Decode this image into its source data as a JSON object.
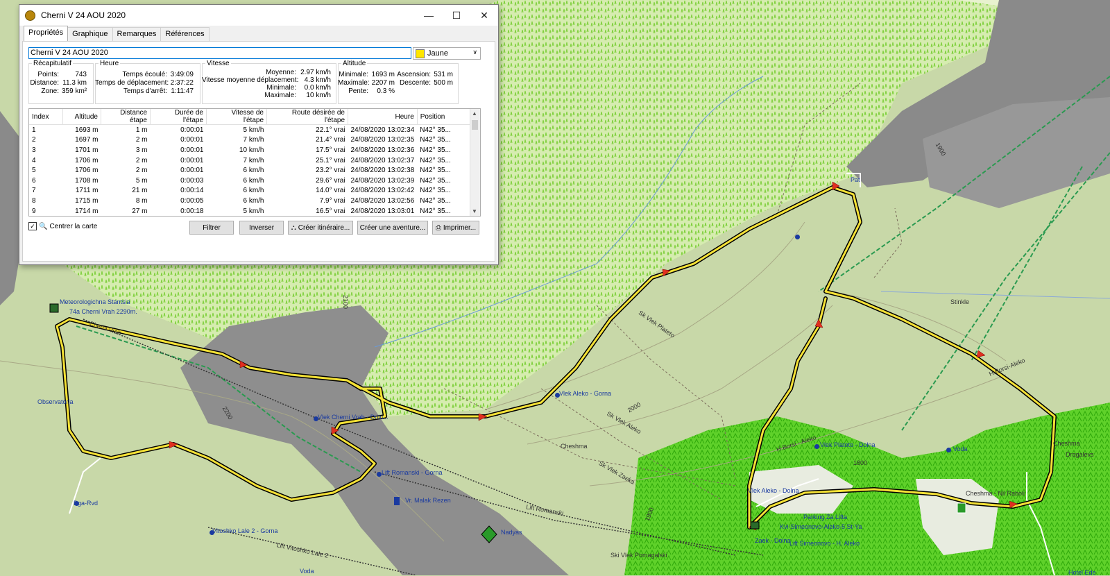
{
  "window": {
    "title": "Cherni V 24 AOU 2020"
  },
  "tabs": [
    "Propriétés",
    "Graphique",
    "Remarques",
    "Références"
  ],
  "name_value": "Cherni V 24 AOU 2020",
  "color": {
    "label": "Jaune",
    "swatch": "#ffe600"
  },
  "recap": {
    "legend": "Récapitulatif",
    "rows": [
      {
        "label": "Points:",
        "value": "743"
      },
      {
        "label": "Distance:",
        "value": "11.3 km"
      },
      {
        "label": "Zone:",
        "value": "359 km²"
      }
    ]
  },
  "heure": {
    "legend": "Heure",
    "rows": [
      {
        "label": "Temps écoulé:",
        "value": "3:49:09"
      },
      {
        "label": "Temps de déplacement:",
        "value": "2:37:22"
      },
      {
        "label": "Temps d'arrêt:",
        "value": "1:11:47"
      }
    ]
  },
  "vitesse": {
    "legend": "Vitesse",
    "rows": [
      {
        "label": "Moyenne:",
        "value": "2.97 km/h"
      },
      {
        "label": "Vitesse moyenne déplacement:",
        "value": "4.3 km/h"
      },
      {
        "label": "Minimale:",
        "value": "0.0 km/h"
      },
      {
        "label": "Maximale:",
        "value": "10 km/h"
      }
    ]
  },
  "altitude": {
    "legend": "Altitude",
    "rows": [
      {
        "label": "Minimale:",
        "value": "1693 m",
        "label2": "Ascension:",
        "value2": "531 m"
      },
      {
        "label": "Maximale:",
        "value": "2207 m",
        "label2": "Descente:",
        "value2": "500 m"
      },
      {
        "label": "Pente:",
        "value": "0.3 %"
      }
    ]
  },
  "table": {
    "headers": [
      "Index",
      "Altitude",
      "Distance étape",
      "Durée de l'étape",
      "Vitesse de l'étape",
      "Route désirée de l'étape",
      "Heure",
      "Position"
    ],
    "rows": [
      [
        "1",
        "1693 m",
        "1 m",
        "0:00:01",
        "5 km/h",
        "22.1° vrai",
        "24/08/2020 13:02:34",
        "N42° 35..."
      ],
      [
        "2",
        "1697 m",
        "2 m",
        "0:00:01",
        "7 km/h",
        "21.4° vrai",
        "24/08/2020 13:02:35",
        "N42° 35..."
      ],
      [
        "3",
        "1701 m",
        "3 m",
        "0:00:01",
        "10 km/h",
        "17.5° vrai",
        "24/08/2020 13:02:36",
        "N42° 35..."
      ],
      [
        "4",
        "1706 m",
        "2 m",
        "0:00:01",
        "7 km/h",
        "25.1° vrai",
        "24/08/2020 13:02:37",
        "N42° 35..."
      ],
      [
        "5",
        "1706 m",
        "2 m",
        "0:00:01",
        "6 km/h",
        "23.2° vrai",
        "24/08/2020 13:02:38",
        "N42° 35..."
      ],
      [
        "6",
        "1708 m",
        "5 m",
        "0:00:03",
        "6 km/h",
        "29.6° vrai",
        "24/08/2020 13:02:39",
        "N42° 35..."
      ],
      [
        "7",
        "1711 m",
        "21 m",
        "0:00:14",
        "6 km/h",
        "14.0° vrai",
        "24/08/2020 13:02:42",
        "N42° 35..."
      ],
      [
        "8",
        "1715 m",
        "8 m",
        "0:00:05",
        "6 km/h",
        "7.9° vrai",
        "24/08/2020 13:02:56",
        "N42° 35..."
      ],
      [
        "9",
        "1714 m",
        "27 m",
        "0:00:18",
        "5 km/h",
        "16.5° vrai",
        "24/08/2020 13:03:01",
        "N42° 35..."
      ]
    ]
  },
  "center_map": {
    "label": "Centrer la carte",
    "checked": true
  },
  "buttons": {
    "filter": "Filtrer",
    "invert": "Inverser",
    "create_route": "Créer itinéraire...",
    "create_adventure": "Créer une aventure...",
    "print": "Imprimer..."
  },
  "map_labels": {
    "meteo": "Meteorologichna Stantsia",
    "peak": "74a Cherni Vrah 2290m.",
    "cherni_vrah": "Cherni Vrah",
    "observatoria": "Observatoria",
    "bga_rvd": "Bga-Rvd",
    "vlek_cherni_dolna": "Vlek Cherni Vrah - Doln...",
    "lift_romanski_gorna": "Lift Romanski - Gorna",
    "malak_rezen": "Vr. Malak Rezen",
    "lift_romanski": "Lift Romanski",
    "nadyas": "Nadyas",
    "vitoshko_lale": "Vitoshko Lale 2 - Gorna",
    "lift_vitoshko": "Lift Vitoshko Lale 2",
    "voda1": "Voda",
    "sk_vlek_pomagalski": "Ski Vlek Pomagalski",
    "vlek_aleko_gorna": "Vlek Aleko - Gorna",
    "sk_vlek_aleko": "Sk Vlek Aleko",
    "sk_vlek_zaeka": "Sk Vlek Zaeka",
    "sk_vlek_plateto": "Sk Vlek Plateto",
    "cheshma1": "Cheshma",
    "vlek_platoto": "Vlek Platoto - Dolna",
    "h_borsi_aleko": "H.Borsi - Aleko",
    "aleko_dolna": "Vlek Aleko - Dolna",
    "parking": "Parking Za Lifta",
    "kvi_simeonovo": "Kvi-Simeonovo-Aleko-5 St-Ya",
    "zaek_dolna": "Zaek - Dolna",
    "lift_simeonovo": "Lift Simeonovo - H. Aleko",
    "voda2": "Voda",
    "cheshma2": "Cheshma",
    "cheshma_nil": "Cheshma - Nil Raboli",
    "hotel_edel": "Hotel Ede",
    "dragalevs": "Dragalevs",
    "h_borsi_aleko2": "H.Borsi-Aleko",
    "pat": "Pat",
    "stinkle": "Stinkle",
    "c1800": "1800",
    "c1900": "1900",
    "c2000": "2000",
    "c2100": "2100",
    "c2200": "2200",
    "c1900b": "1900"
  }
}
